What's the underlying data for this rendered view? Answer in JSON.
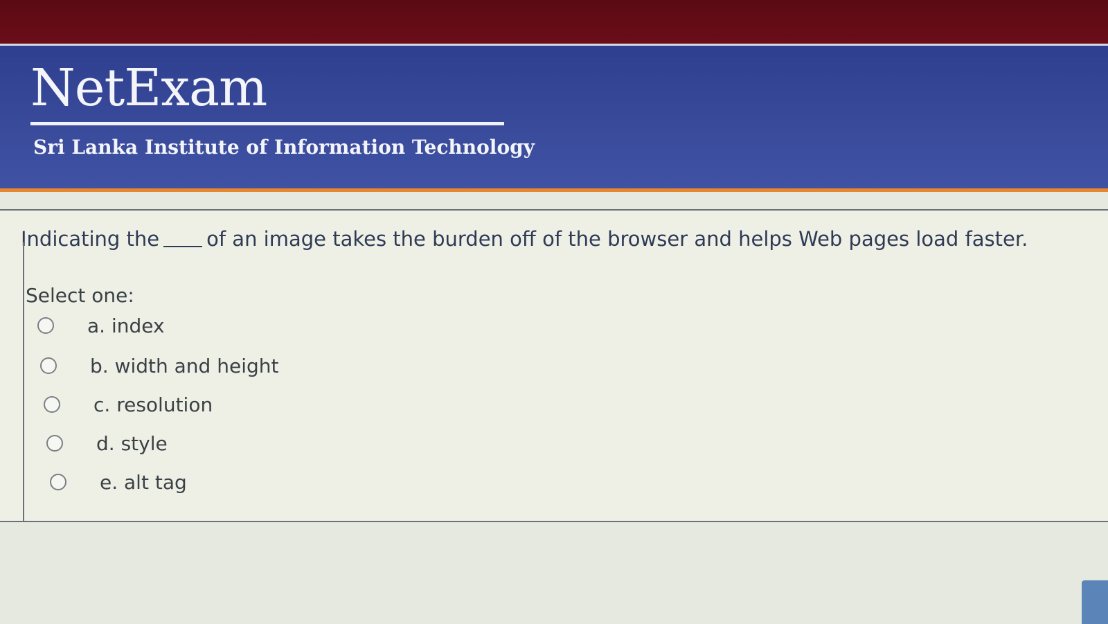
{
  "header": {
    "brand": "NetExam",
    "institution": "Sri Lanka Institute of Information Technology"
  },
  "question": {
    "text_before": "Indicating the",
    "text_after": "of an image takes the burden off of the browser and helps Web pages load faster.",
    "prompt": "Select one:",
    "options": [
      {
        "label": "a. index"
      },
      {
        "label": "b. width and height"
      },
      {
        "label": "c. resolution"
      },
      {
        "label": "d. style"
      },
      {
        "label": "e. alt tag"
      }
    ]
  },
  "colors": {
    "top_bar": "#5a0a14",
    "banner": "#3a4b9c",
    "accent_line": "#e8862f",
    "question_text": "#2f3a55"
  }
}
